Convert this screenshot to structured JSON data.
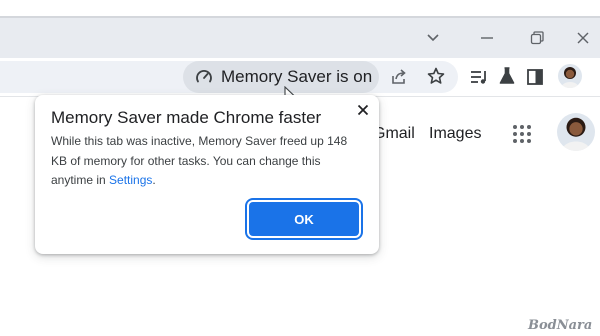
{
  "browser": {
    "window_controls": {
      "tab_search": "chevron-down-icon",
      "minimize": "minimize-icon",
      "restore": "restore-icon",
      "close": "close-icon"
    },
    "chip": {
      "label": "Memory Saver is on",
      "icon": "speedometer-icon"
    },
    "toolbar_icons": [
      "share-icon",
      "bookmark-star-icon",
      "reading-list-icon",
      "labs-flask-icon",
      "side-panel-icon",
      "profile-avatar"
    ]
  },
  "page": {
    "nav_gmail": "Gmail",
    "nav_images": "Images"
  },
  "popup": {
    "title": "Memory Saver made Chrome faster",
    "body_text": "While this tab was inactive, Memory Saver freed up 148 KB of memory for other tasks. You can change this anytime in ",
    "settings_link": "Settings",
    "body_end": ".",
    "ok_label": "OK"
  },
  "watermark": "BodNara",
  "colors": {
    "accent": "#1a73e8",
    "chip_bg": "#dde1e7",
    "titlebar_bg": "#e8ebf0"
  }
}
